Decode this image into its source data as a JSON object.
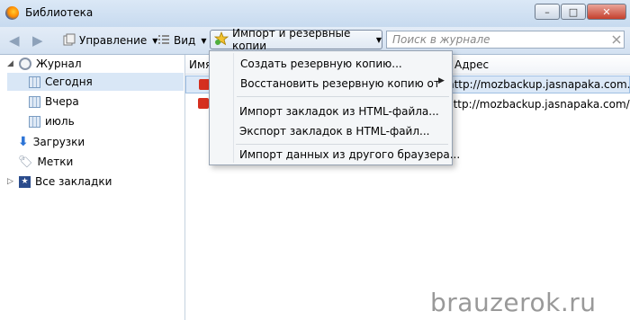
{
  "window": {
    "title": "Библиотека",
    "controls": {
      "minimize": "–",
      "maximize": "□",
      "close": "✕"
    }
  },
  "toolbar": {
    "back_icon": "back-arrow-icon",
    "forward_icon": "forward-arrow-icon",
    "manage_label": "Управление",
    "view_label": "Вид",
    "import_label": "Импорт и резервные копии",
    "search_placeholder": "Поиск в журнале"
  },
  "sidebar": {
    "items": [
      {
        "label": "Журнал",
        "icon": "clock-icon"
      },
      {
        "label": "Сегодня",
        "icon": "calendar-icon"
      },
      {
        "label": "Вчера",
        "icon": "calendar-icon"
      },
      {
        "label": "июль",
        "icon": "calendar-icon"
      },
      {
        "label": "Загрузки",
        "icon": "download-icon"
      },
      {
        "label": "Метки",
        "icon": "tag-icon"
      },
      {
        "label": "Все закладки",
        "icon": "bookmarks-star-icon"
      }
    ]
  },
  "list": {
    "col_name": "Имя",
    "col_address": "Адрес",
    "rows": [
      {
        "address": "http://mozbackup.jasnapaka.com..."
      },
      {
        "address": "http://mozbackup.jasnapaka.com/"
      }
    ]
  },
  "menu": {
    "items": [
      {
        "label": "Создать резервную копию..."
      },
      {
        "label": "Восстановить резервную копию от"
      },
      {
        "label": "Импорт закладок из HTML-файла..."
      },
      {
        "label": "Экспорт закладок в HTML-файл..."
      },
      {
        "label": "Импорт данных из другого браузера..."
      }
    ],
    "highlight_color": "#f3f328"
  },
  "watermark": "brauzerok.ru"
}
